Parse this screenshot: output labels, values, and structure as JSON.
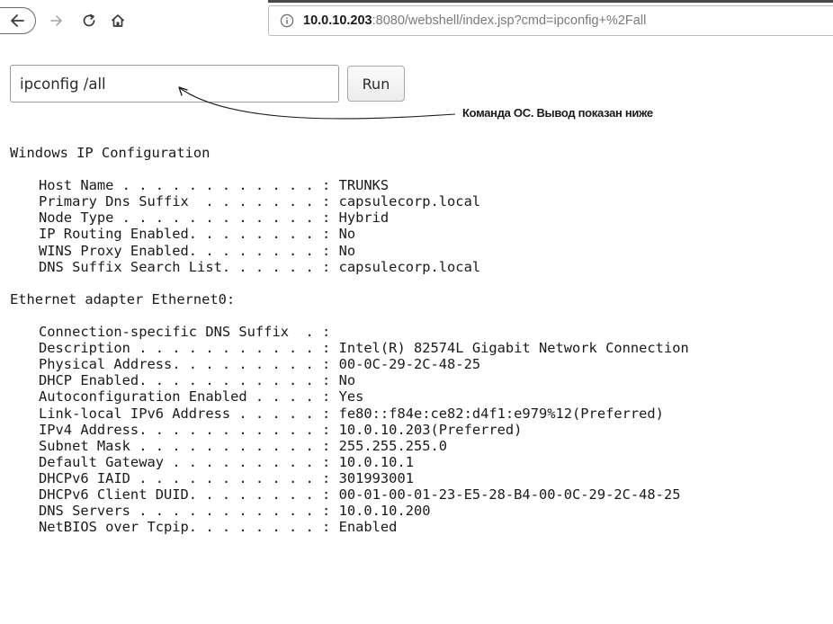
{
  "browser": {
    "url_host": "10.0.10.203",
    "url_rest": ":8080/webshell/index.jsp?cmd=ipconfig+%2Fall",
    "icons": {
      "back": "arrow-left-icon",
      "forward": "arrow-right-icon",
      "reload": "reload-icon",
      "home": "home-icon",
      "info": "info-icon"
    }
  },
  "form": {
    "command_value": "ipconfig /all",
    "run_label": "Run"
  },
  "annotation": {
    "text": "Команда ОС. Вывод показан ниже"
  },
  "output": {
    "header": "Windows IP Configuration",
    "host_section": [
      {
        "key": "Host Name . . . . . . . . . . . . : ",
        "value": "TRUNKS"
      },
      {
        "key": "Primary Dns Suffix  . . . . . . . : ",
        "value": "capsulecorp.local"
      },
      {
        "key": "Node Type . . . . . . . . . . . . : ",
        "value": "Hybrid"
      },
      {
        "key": "IP Routing Enabled. . . . . . . . : ",
        "value": "No"
      },
      {
        "key": "WINS Proxy Enabled. . . . . . . . : ",
        "value": "No"
      },
      {
        "key": "DNS Suffix Search List. . . . . . : ",
        "value": "capsulecorp.local"
      }
    ],
    "adapter_header": "Ethernet adapter Ethernet0:",
    "adapter_section": [
      {
        "key": "Connection-specific DNS Suffix  . : ",
        "value": ""
      },
      {
        "key": "Description . . . . . . . . . . . : ",
        "value": "Intel(R) 82574L Gigabit Network Connection"
      },
      {
        "key": "Physical Address. . . . . . . . . : ",
        "value": "00-0C-29-2C-48-25"
      },
      {
        "key": "DHCP Enabled. . . . . . . . . . . : ",
        "value": "No"
      },
      {
        "key": "Autoconfiguration Enabled . . . . : ",
        "value": "Yes"
      },
      {
        "key": "Link-local IPv6 Address . . . . . : ",
        "value": "fe80::f84e:ce82:d4f1:e979%12(Preferred)"
      },
      {
        "key": "IPv4 Address. . . . . . . . . . . : ",
        "value": "10.0.10.203(Preferred)"
      },
      {
        "key": "Subnet Mask . . . . . . . . . . . : ",
        "value": "255.255.255.0"
      },
      {
        "key": "Default Gateway . . . . . . . . . : ",
        "value": "10.0.10.1"
      },
      {
        "key": "DHCPv6 IAID . . . . . . . . . . . : ",
        "value": "301993001"
      },
      {
        "key": "DHCPv6 Client DUID. . . . . . . . : ",
        "value": "00-01-00-01-23-E5-28-B4-00-0C-29-2C-48-25"
      },
      {
        "key": "DNS Servers . . . . . . . . . . . : ",
        "value": "10.0.10.200"
      },
      {
        "key": "NetBIOS over Tcpip. . . . . . . . : ",
        "value": "Enabled"
      }
    ]
  }
}
